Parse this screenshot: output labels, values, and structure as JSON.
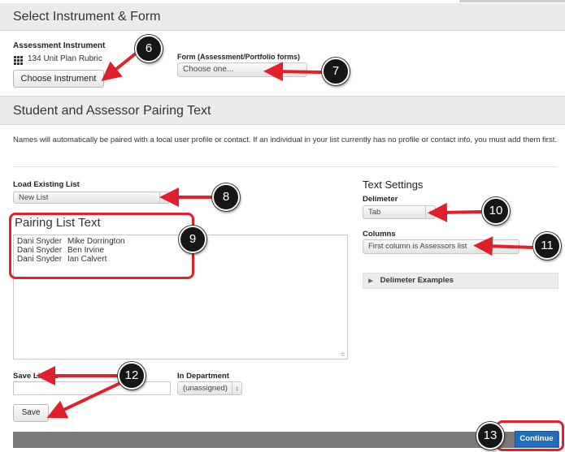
{
  "select_section": {
    "title": "Select Instrument & Form"
  },
  "instrument": {
    "label": "Assessment Instrument",
    "name": "134 Unit Plan Rubric",
    "icon": "grid-icon",
    "choose_button": "Choose Instrument"
  },
  "form": {
    "label": "Form (Assessment/Portfolio forms)",
    "selected": "Choose one..."
  },
  "pairing_section": {
    "title": "Student and Assessor Pairing Text",
    "description": "Names will automatically be paired with a local user profile or contact. If an individual in your list currently has no profile or contact info, you must add them first."
  },
  "load_list": {
    "label": "Load Existing List",
    "selected": "New List"
  },
  "pairing_text": {
    "title": "Pairing List Text",
    "rows": [
      [
        "Dani Snyder",
        "Mike Dorrington"
      ],
      [
        "Dani Snyder",
        "Ben Irvine"
      ],
      [
        "Dani Snyder",
        "Ian Calvert"
      ]
    ]
  },
  "text_settings": {
    "title": "Text Settings",
    "delimeter_label": "Delimeter",
    "delimeter_value": "Tab",
    "columns_label": "Columns",
    "columns_value": "First column is Assessors list",
    "examples_label": "Delimeter Examples"
  },
  "save_list": {
    "label": "Save List As",
    "value": "",
    "save_button": "Save"
  },
  "department": {
    "label": "In Department",
    "selected": "(unassigned)"
  },
  "footer": {
    "continue_button": "Continue"
  },
  "callouts": [
    "6",
    "7",
    "8",
    "9",
    "10",
    "11",
    "12",
    "13"
  ],
  "colors": {
    "callout_red": "#e0202a",
    "continue_blue": "#1f6fc1",
    "footer_bar": "#7a7a7a"
  }
}
